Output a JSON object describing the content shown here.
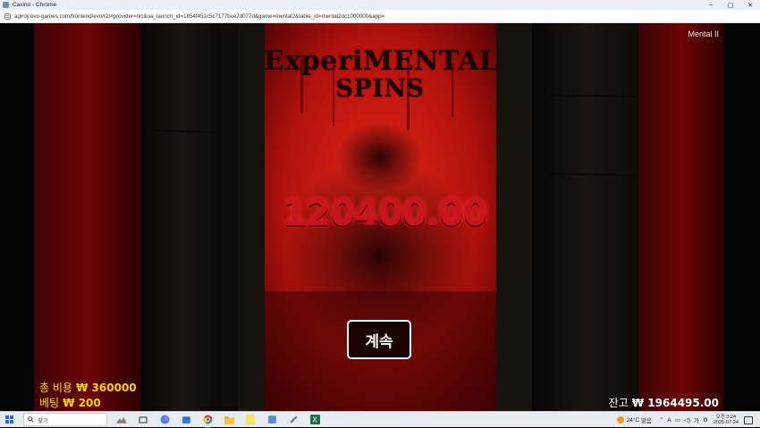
{
  "window": {
    "title": "Casino - Chrome",
    "controls": {
      "minimize": "–",
      "maximize": "▢",
      "close": "✕"
    }
  },
  "address_bar": {
    "url": "agiroy.evo-games.com/frontend/evo/r2/#provider=nlc&ua_launch_id=1854f451c5c7177bce7d077d&game=mental2&table_id=mental2dc1000000&app="
  },
  "game": {
    "name_tag": "Mental II",
    "logo_line1": "ExperiMENTAL",
    "logo_line2": "SPINS",
    "win_amount": "120400.00",
    "continue_label": "계속",
    "total_bet_label": "총 비용",
    "total_bet_value": "₩ 360000",
    "bet_label": "베팅",
    "bet_value": "₩ 200",
    "balance_label": "잔고",
    "balance_value": "₩ 1964495.00",
    "accent_red": "#c8141d",
    "hud_yellow": "#ffd400"
  },
  "taskbar": {
    "search_placeholder": "찾기",
    "weather_temp": "24°C",
    "weather_text": "맑음",
    "tray_lang": "A",
    "clock_time": "오전 3:24",
    "clock_date": "2025-07-24",
    "apps": [
      "task-view-icon",
      "copilot-icon",
      "store-icon",
      "chrome-icon",
      "file-explorer-icon",
      "notes-icon",
      "python-icon",
      "tool-icon",
      "excel-icon"
    ]
  }
}
